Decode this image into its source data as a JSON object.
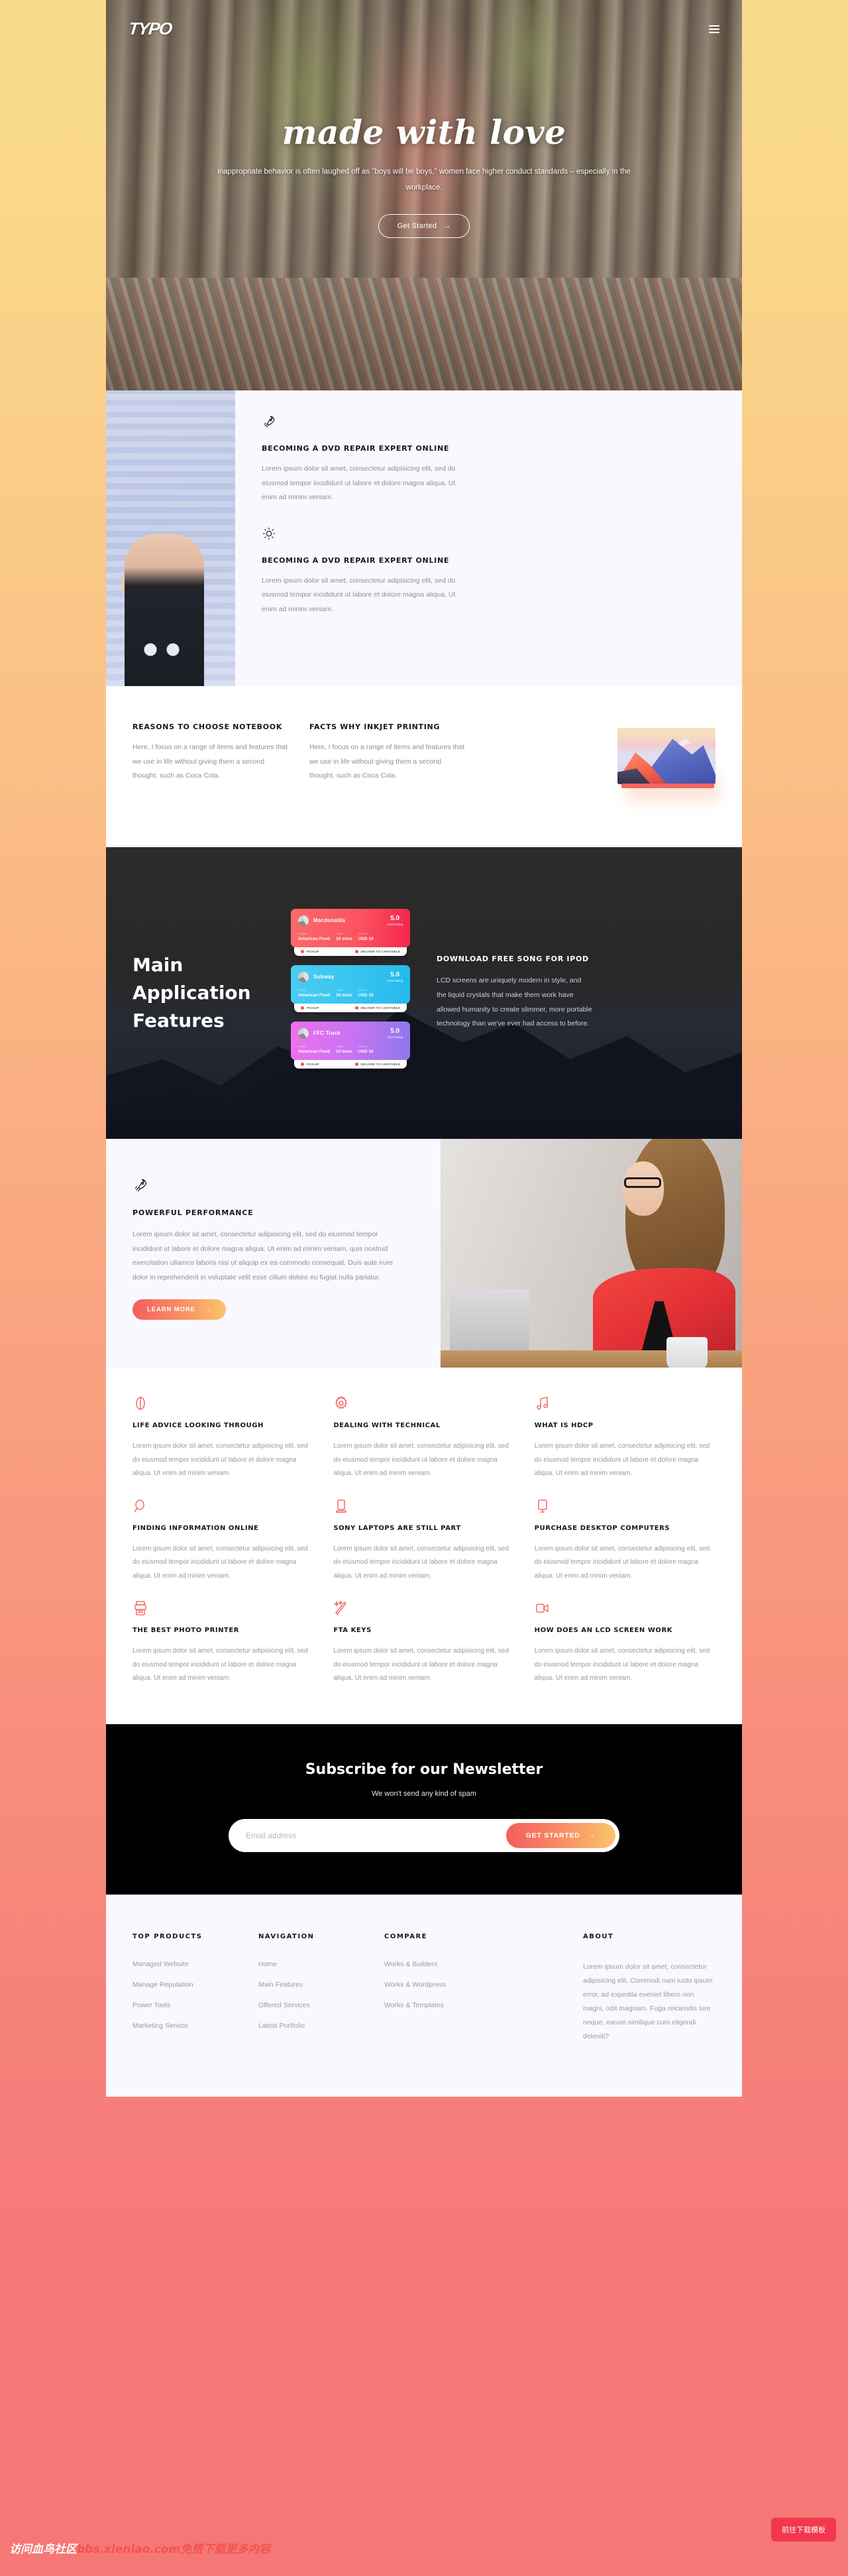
{
  "brand": {
    "logo": "TYPO",
    "menu_icon": "hamburger-icon"
  },
  "hero": {
    "title": "made with love",
    "subtitle": "inappropriate behavior is often laughed off as \"boys will be boys,\" women face higher conduct standards – especially in the workplace.",
    "cta": "Get Started",
    "cta_arrow": "→"
  },
  "section2": {
    "blocks": [
      {
        "icon": "rocket-icon",
        "heading": "BECOMING A DVD REPAIR EXPERT ONLINE",
        "body": "Lorem ipsum dolor sit amet, consectetur adipisicing elit, sed do eiusmod tempor incididunt ut labore et dolore magna aliqua. Ut enim ad minim veniam."
      },
      {
        "icon": "sun-icon",
        "heading": "BECOMING A DVD REPAIR EXPERT ONLINE",
        "body": "Lorem ipsum dolor sit amet, consectetur adipisicing elit, sed do eiusmod tempor incididunt ut labore et dolore magna aliqua. Ut enim ad minim veniam."
      }
    ]
  },
  "section3": {
    "columns": [
      {
        "heading": "REASONS TO CHOOSE NOTEBOOK",
        "body": "Here, I focus on a range of items and features that we use in life without giving them a second thought. such as Coca Cola."
      },
      {
        "heading": "FACTS WHY INKJET PRINTING",
        "body": "Here, I focus on a range of items and features that we use in life without giving them a second thought. such as Coca Cola."
      }
    ],
    "image_alt": "mountain-illustration"
  },
  "features_dark": {
    "title": "Main Application Features",
    "cards": [
      {
        "name": "Macdonalds",
        "score": "5.0",
        "rating_label": "1034 Rating",
        "meta": [
          {
            "label": "FOOD",
            "value": "American Food"
          },
          {
            "label": "TIME",
            "value": "10 mins"
          },
          {
            "label": "PRICE",
            "value": "USD 10"
          }
        ],
        "actions": [
          "PICKUP",
          "DELIVER TO CARITABLE"
        ]
      },
      {
        "name": "Subway",
        "score": "5.0",
        "rating_label": "1034 Rating",
        "meta": [
          {
            "label": "FOOD",
            "value": "American Food"
          },
          {
            "label": "TIME",
            "value": "10 mins"
          },
          {
            "label": "PRICE",
            "value": "USD 10"
          }
        ],
        "actions": [
          "PICKUP",
          "DELIVER TO CARITABLE"
        ]
      },
      {
        "name": "FFC Truck",
        "score": "5.0",
        "rating_label": "1034 Rating",
        "meta": [
          {
            "label": "FOOD",
            "value": "American Food"
          },
          {
            "label": "TIME",
            "value": "10 mins"
          },
          {
            "label": "PRICE",
            "value": "USD 10"
          }
        ],
        "actions": [
          "PICKUP",
          "DELIVER TO CARITABLE"
        ]
      }
    ],
    "side": {
      "heading": "DOWNLOAD FREE SONG FOR IPOD",
      "body": "LCD screens are uniquely modern in style, and the liquid crystals that make them work have allowed humanity to create slimmer, more portable technology than we've ever had access to before."
    }
  },
  "performance": {
    "icon": "rocket-icon",
    "heading": "POWERFUL PERFORMANCE",
    "body": "Lorem ipsum dolor sit amet, consectetur adipisicing elit, sed do eiusmod tempor incididunt ut labore et dolore magna aliqua. Ut enim ad minim veniam, quis nostrud exercitation ullamco laboris nisi ut aliquip ex ea commodo consequat. Duis aute irure dolor in reprehenderit in voluptate velit esse cillum dolore eu fugiat nulla pariatur.",
    "cta": "LEARN MORE",
    "cta_arrow": "→"
  },
  "grid": {
    "body_text": "Lorem ipsum dolor sit amet, consectetur adipisicing elit, sed do eiusmod tempor incididunt ut labore et dolore magna aliqua. Ut enim ad minim veniam.",
    "items": [
      {
        "icon": "eye-icon",
        "title": "LIFE ADVICE LOOKING THROUGH"
      },
      {
        "icon": "gear-icon",
        "title": "DEALING WITH TECHNICAL"
      },
      {
        "icon": "music-icon",
        "title": "WHAT IS HDCP"
      },
      {
        "icon": "search-icon",
        "title": "FINDING INFORMATION ONLINE"
      },
      {
        "icon": "laptop-icon",
        "title": "SONY LAPTOPS ARE STILL PART"
      },
      {
        "icon": "monitor-icon",
        "title": "PURCHASE DESKTOP COMPUTERS"
      },
      {
        "icon": "printer-icon",
        "title": "THE BEST PHOTO PRINTER"
      },
      {
        "icon": "magic-wand-icon",
        "title": "FTA KEYS"
      },
      {
        "icon": "video-icon",
        "title": "HOW DOES AN LCD SCREEN WORK"
      }
    ]
  },
  "newsletter": {
    "title": "Subscribe for our Newsletter",
    "subtitle": "We won't send any kind of spam",
    "input_placeholder": "Email address",
    "input_value": "",
    "cta": "GET STARTED",
    "cta_arrow": "→"
  },
  "footer": {
    "columns": [
      {
        "title": "TOP PRODUCTS",
        "links": [
          "Managed Website",
          "Manage Reputation",
          "Power Tools",
          "Marketing Service"
        ]
      },
      {
        "title": "NAVIGATION",
        "links": [
          "Home",
          "Main Features",
          "Offered Services",
          "Latest Portfolio"
        ]
      },
      {
        "title": "COMPARE",
        "links": [
          "Works & Builders",
          "Works & Wordpress",
          "Works & Templates"
        ]
      }
    ],
    "about": {
      "title": "ABOUT",
      "body": "Lorem ipsum dolor sit amet, consectetur adipisicing elit. Commodi nam iusto ipsum error, ad expedita eveniet libero non magni, odit magnam. Fuga reiciendis iure neque, earum similique cum eligendi deleniti?"
    }
  },
  "overlays": {
    "watermark_prefix": "访问血鸟社区",
    "watermark_url": "bbs.xienlao.com",
    "watermark_suffix": "免费下载更多内容",
    "download_button": "前往下载模板"
  },
  "colors": {
    "accent_red": "#f4534f",
    "gradient_start": "#f45e5e",
    "gradient_end": "#fbc56c",
    "dark_bg": "#2f2d2b",
    "panel_bg": "#f8f8fe"
  }
}
